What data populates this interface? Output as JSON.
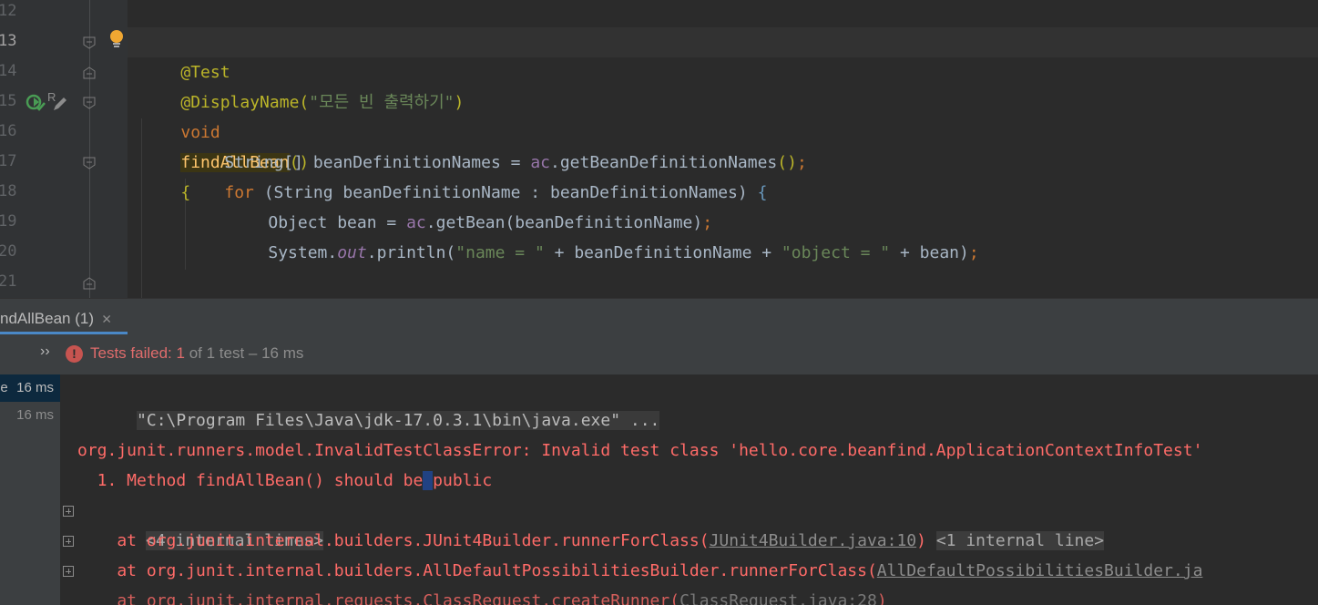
{
  "editor": {
    "line_numbers": [
      "12",
      "13",
      "14",
      "15",
      "16",
      "17",
      "18",
      "19",
      "20",
      "21"
    ],
    "active_line": "13",
    "code": {
      "l13_annotation": "@Test",
      "l14_annotation": "@DisplayName(",
      "l14_string": "\"모든 빈 출력하기\"",
      "l14_close": ")",
      "l15_kw": "void",
      "l15_name": "findAllBean",
      "l15_parens": "()",
      "l15_brace": "{",
      "l16_text": "String[] beanDefinitionNames = ",
      "l16_var": "ac",
      "l16_call": ".getBeanDefinitionNames",
      "l16_parens": "()",
      "l16_semi": ";",
      "l17_kw": "for",
      "l17_text": " (String beanDefinitionName : beanDefinitionNames) ",
      "l17_brace": "{",
      "l18_text": "Object bean = ",
      "l18_var": "ac",
      "l18_call": ".getBean(beanDefinitionName)",
      "l18_semi": ";",
      "l19_a": "System.",
      "l19_field": "out",
      "l19_b": ".println(",
      "l19_str1": "\"name = \"",
      "l19_c": " + beanDefinitionName + ",
      "l19_str2": "\"object = \"",
      "l19_d": " + bean)",
      "l19_semi": ";",
      "l21_brace": "}"
    },
    "gutter_icons": [
      "lightbulb-icon",
      "run-test-passed-icon",
      "edit-icon"
    ]
  },
  "run_panel": {
    "tab_label": "ndAllBean (1)",
    "tab_close": "✕",
    "status": {
      "expand_glyph": "››",
      "error_glyph": "!",
      "failed_label": "Tests failed: ",
      "failed_count": "1",
      "summary": " of 1 test – 16 ms"
    },
    "tree": [
      {
        "name": "ne",
        "time": "16 ms",
        "selected": true
      },
      {
        "name": "",
        "time": "16 ms",
        "selected": false
      }
    ],
    "console": {
      "cmd": "\"C:\\Program Files\\Java\\jdk-17.0.3.1\\bin\\java.exe\" ...",
      "error_header": "org.junit.runners.model.InvalidTestClassError: Invalid test class 'hello.core.beanfind.ApplicationContextInfoTest'",
      "method_msg_a": "  1. Method findAllBean() should be",
      "method_msg_caret": " ",
      "method_msg_b": "public",
      "internal4": "<4 internal lines>",
      "stack1_prefix": "    at org.junit.internal.builders.JUnit4Builder.runnerForClass(",
      "stack1_link": "JUnit4Builder.java:10",
      "stack1_suffix": ")",
      "stack1_chip": "<1 internal line>",
      "stack2_prefix": "    at org.junit.internal.builders.AllDefaultPossibilitiesBuilder.runnerForClass(",
      "stack2_link": "AllDefaultPossibilitiesBuilder.ja",
      "stack3_prefix": "    at org.junit.internal.requests.ClassRequest.createRunner(",
      "stack3_link": "ClassRequest.java:28",
      "stack3_suffix": ")"
    }
  },
  "colors": {
    "editor_bg": "#2b2b2b",
    "gutter_bg": "#313335",
    "annotation": "#bbb529",
    "keyword": "#cc7832",
    "string": "#6a8759",
    "function": "#ffc66d",
    "error_red": "#ff6b68",
    "tab_accent": "#4a88c7"
  }
}
